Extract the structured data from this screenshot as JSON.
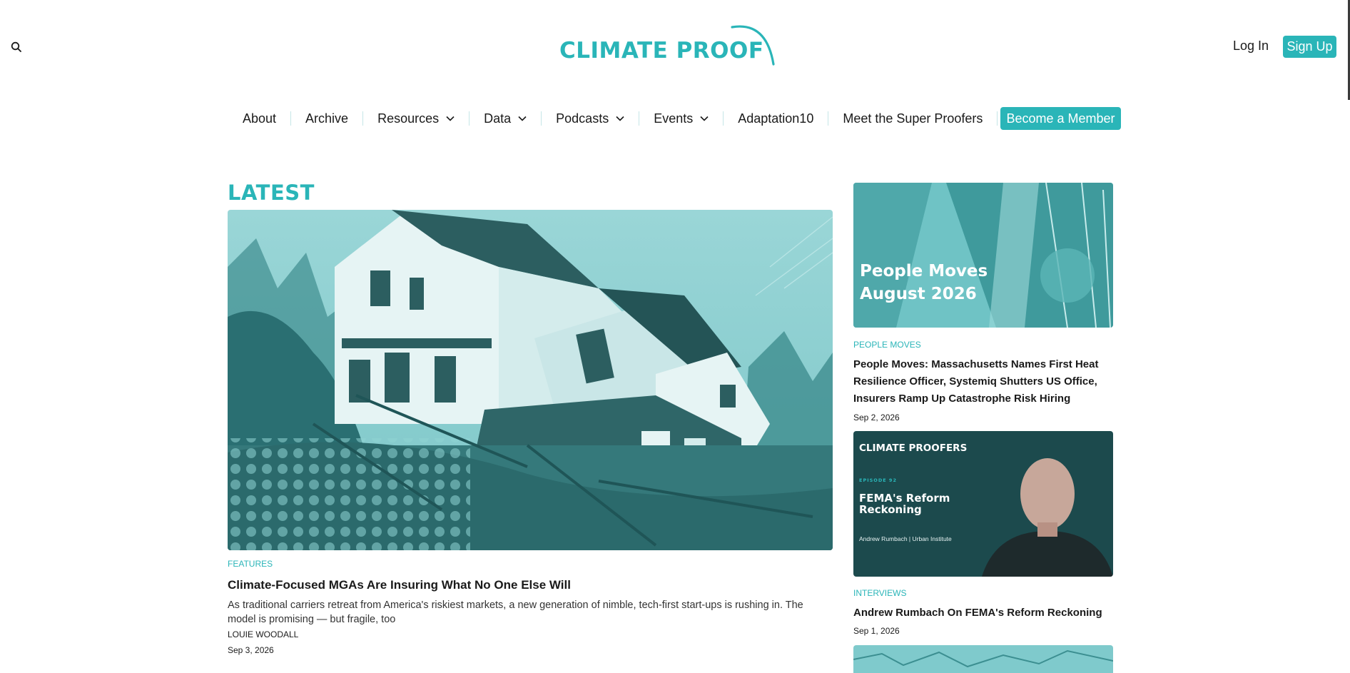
{
  "header": {
    "logo_text": "CLIMATE PROOF",
    "login_label": "Log In",
    "signup_label": "Sign Up"
  },
  "nav": {
    "items": [
      {
        "label": "About"
      },
      {
        "label": "Archive"
      },
      {
        "label": "Resources"
      },
      {
        "label": "Data"
      },
      {
        "label": "Podcasts"
      },
      {
        "label": "Events"
      },
      {
        "label": "Adaptation10"
      },
      {
        "label": "Meet the Super Proofers"
      }
    ],
    "cta_label": "Become a Member"
  },
  "latest": {
    "heading": "LATEST",
    "hero": {
      "category": "FEATURES",
      "title": "Climate-Focused MGAs Are Insuring What No One Else Will",
      "dek": "As traditional carriers retreat from America's riskiest markets, a new generation of nimble, tech-first start-ups is rushing in. The model is promising  — but fragile, too",
      "author": "LOUIE WOODALL",
      "date": "Sep 3, 2026"
    },
    "side": [
      {
        "image_overlay": "People Moves August 2026",
        "category": "PEOPLE MOVES",
        "title": "People Moves: Massachusetts Names First Heat Resilience Officer, Systemiq Shutters US Office, Insurers Ramp Up Catastrophe Risk Hiring",
        "date": "Sep 2, 2026"
      },
      {
        "image_logo": "CLIMATE PROOFERS",
        "image_episode": "EPISODE 92",
        "image_title": "FEMA's Reform Reckoning",
        "image_guest": "Andrew Rumbach | Urban Institute",
        "category": "INTERVIEWS",
        "title": "Andrew Rumbach On FEMA's Reform Reckoning",
        "date": "Sep 1, 2026"
      }
    ]
  },
  "colors": {
    "brand": "#2ab5b8",
    "dark_teal": "#1c4a4d",
    "text": "#1a1a1a"
  },
  "icons": [
    "search-icon",
    "chevron-down-icon"
  ]
}
